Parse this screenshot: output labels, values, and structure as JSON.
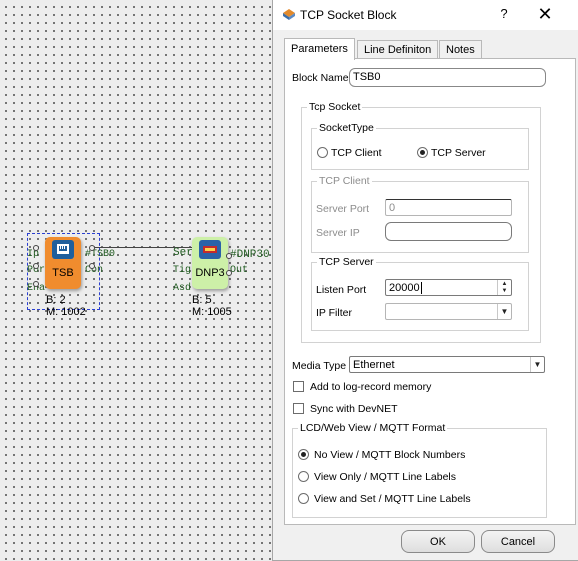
{
  "canvas": {
    "tsb_block": {
      "name": "TSB",
      "bus": "B: 2",
      "module": "M: 1002",
      "pins_left": [
        "Ip",
        "Por",
        "Ena"
      ],
      "pins_right": [
        "#TSB0",
        "Con"
      ],
      "color": "#f08c2e"
    },
    "dnp_block": {
      "name": "DNP3",
      "bus": "B: 5",
      "module": "M: 1005",
      "pins_left": [
        "Ser",
        "Tig",
        "Asd"
      ],
      "pins_right": [
        "#DNP30",
        "Out"
      ],
      "color": "#cdf0a8"
    }
  },
  "dialog": {
    "title": "TCP Socket Block",
    "help_label": "?",
    "close_label": "✕",
    "tabs": [
      "Parameters",
      "Line Definiton",
      "Notes"
    ],
    "active_tab": "Parameters",
    "block_name_label": "Block Name",
    "block_name_value": "TSB0",
    "tcp_socket": {
      "title": "Tcp Socket",
      "socket_type_title": "SocketType",
      "client_label": "TCP Client",
      "server_label": "TCP Server",
      "selected": "TCP Server"
    },
    "tcp_client": {
      "title": "TCP Client",
      "server_port_label": "Server Port",
      "server_port_value": "0",
      "server_ip_label": "Server IP",
      "server_ip_value": ""
    },
    "tcp_server": {
      "title": "TCP Server",
      "listen_port_label": "Listen Port",
      "listen_port_value": "20000",
      "ip_filter_label": "IP Filter",
      "ip_filter_value": ""
    },
    "media_type_label": "Media Type",
    "media_type_value": "Ethernet",
    "add_log_label": "Add to log-record memory",
    "add_log_checked": false,
    "sync_devnet_label": "Sync with DevNET",
    "sync_devnet_checked": false,
    "lcd_group": {
      "title": "LCD/Web View / MQTT Format",
      "options": [
        "No View / MQTT Block Numbers",
        "View Only / MQTT Line Labels",
        "View and Set / MQTT Line Labels"
      ],
      "selected": "No View / MQTT Block Numbers"
    },
    "ok_label": "OK",
    "cancel_label": "Cancel"
  }
}
